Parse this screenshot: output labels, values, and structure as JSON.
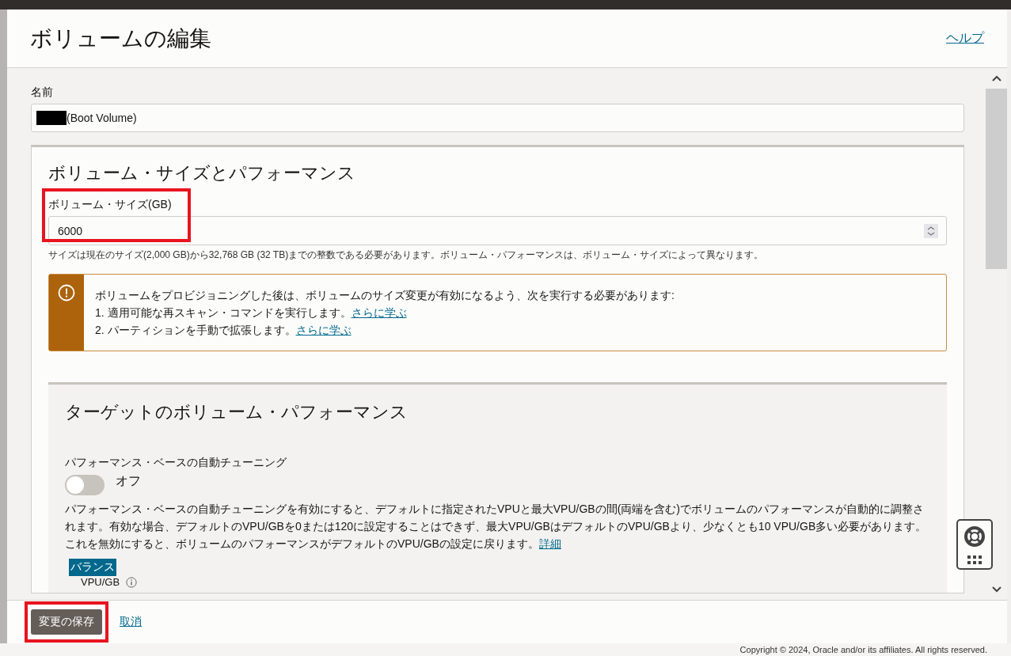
{
  "dialog": {
    "title": "ボリュームの編集",
    "help_link": "ヘルプ"
  },
  "name_field": {
    "label": "名前",
    "value": "(Boot Volume)",
    "redacted": true
  },
  "size_section": {
    "heading": "ボリューム・サイズとパフォーマンス",
    "size_field": {
      "label": "ボリューム・サイズ(GB)",
      "value": "6000",
      "highlighted": true
    },
    "hint": "サイズは現在のサイズ(2,000 GB)から32,768 GB (32 TB)までの整数である必要があります。ボリューム・パフォーマンスは、ボリューム・サイズによって異なります。",
    "warning": {
      "message": "ボリュームをプロビジョニングした後は、ボリュームのサイズ変更が有効になるよう、次を実行する必要があります:",
      "steps": [
        {
          "text": "1. 適用可能な再スキャン・コマンドを実行します。",
          "link": "さらに学ぶ"
        },
        {
          "text": "2. パーティションを手動で拡張します。",
          "link": "さらに学ぶ"
        }
      ]
    }
  },
  "performance_section": {
    "heading": "ターゲットのボリューム・パフォーマンス",
    "auto_tuning": {
      "label": "パフォーマンス・ベースの自動チューニング",
      "on": false,
      "state_label": "オフ"
    },
    "description": "パフォーマンス・ベースの自動チューニングを有効にすると、デフォルトに指定されたVPUと最大VPU/GBの間(両端を含む)でボリュームのパフォーマンスが自動的に調整されます。有効な場合、デフォルトのVPU/GBを0または120に設定することはできず、最大VPU/GBはデフォルトのVPU/GBより、少なくとも10 VPU/GB多い必要があります。これを無効にすると、ボリュームのパフォーマンスがデフォルトのVPU/GBの設定に戻ります。",
    "description_link": "詳細",
    "tag": "バランス",
    "vpu_label": "VPU/GB"
  },
  "footer": {
    "buttons": [
      {
        "label": "変更の保存",
        "kind": "primary",
        "highlighted": true
      },
      {
        "label": "取消",
        "kind": "link",
        "highlighted": false
      }
    ]
  },
  "copyright": "Copyright © 2024, Oracle and/or its affiliates. All rights reserved."
}
